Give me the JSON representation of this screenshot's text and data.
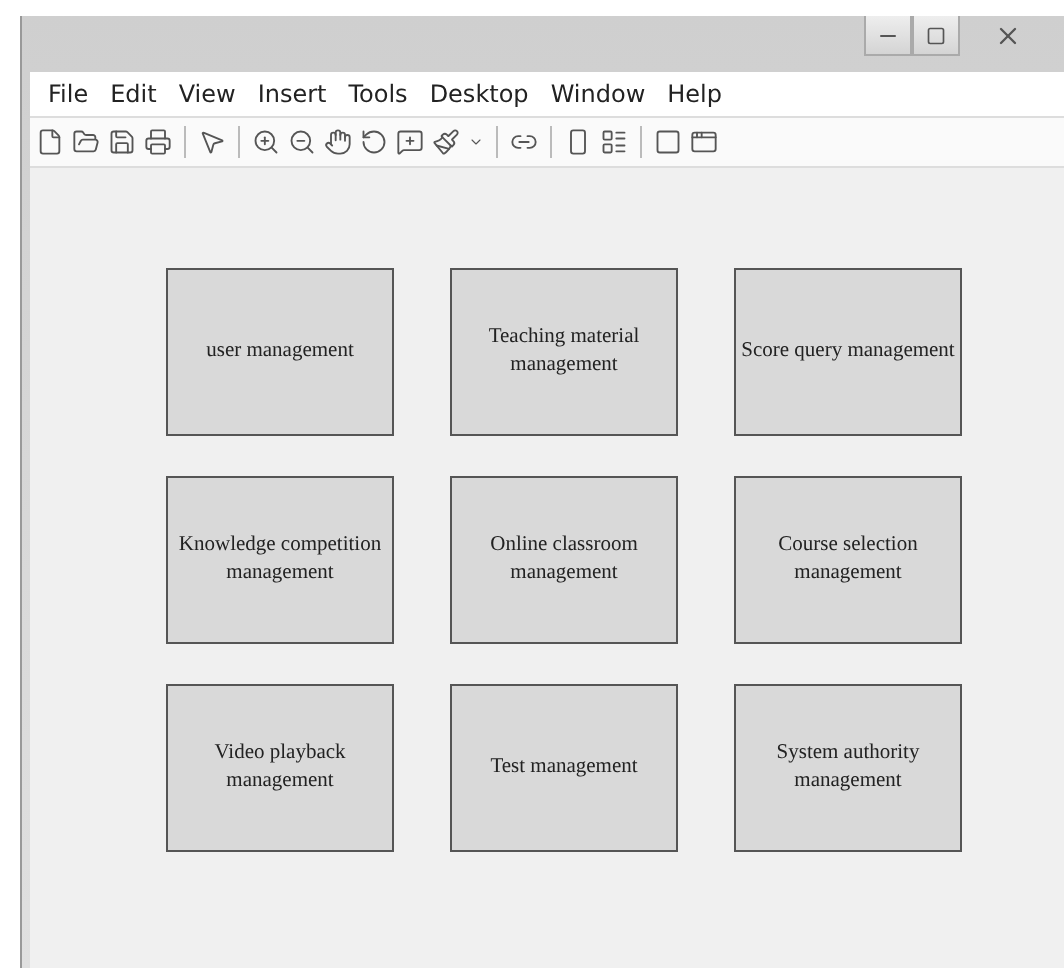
{
  "menu": [
    "File",
    "Edit",
    "View",
    "Insert",
    "Tools",
    "Desktop",
    "Window",
    "Help"
  ],
  "modules": [
    {
      "label": "user management"
    },
    {
      "label": "Teaching material management"
    },
    {
      "label": "Score query management"
    },
    {
      "label": "Knowledge competition management"
    },
    {
      "label": "Online classroom management"
    },
    {
      "label": "Course selection management"
    },
    {
      "label": "Video playback management"
    },
    {
      "label": "Test management"
    },
    {
      "label": "System authority management"
    }
  ]
}
